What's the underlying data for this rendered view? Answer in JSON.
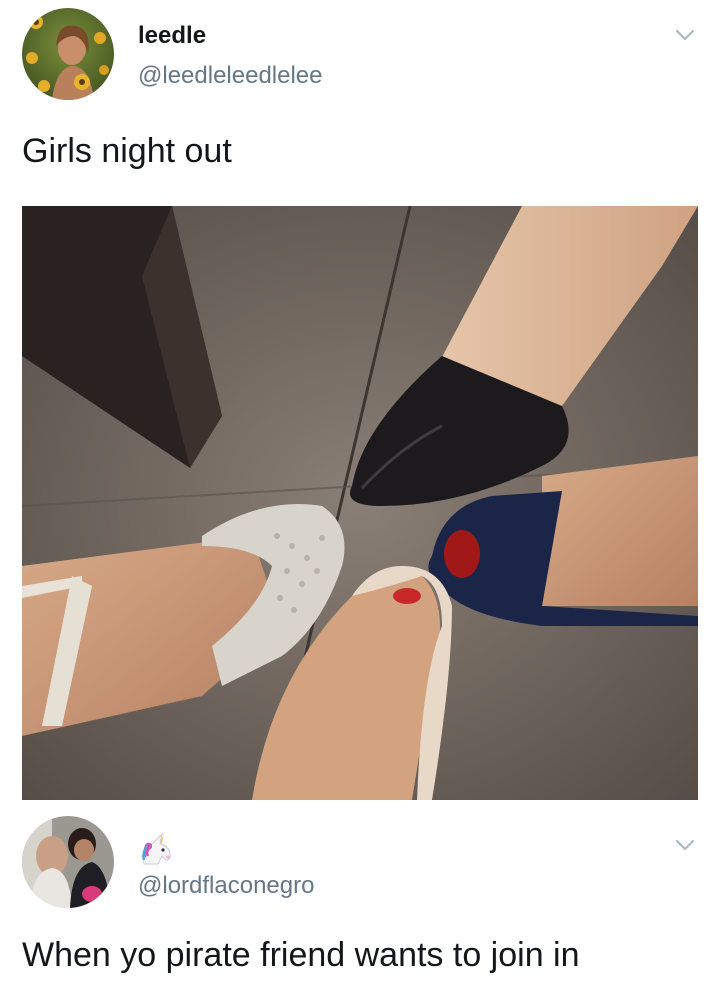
{
  "tweets": [
    {
      "user": {
        "display_name": "leedle",
        "handle": "@leedleleedlelee"
      },
      "text": "Girls night out",
      "media_description": "photo of five feet in heels in a circle, one dark wooden table leg"
    },
    {
      "user": {
        "display_name_icon": "unicorn-emoji",
        "handle": "@lordflaconegro"
      },
      "text": "When yo pirate friend wants to join in"
    }
  ],
  "colors": {
    "text_primary": "#14171a",
    "text_secondary": "#657786",
    "chevron": "#aab8c2"
  },
  "icons": [
    "chevron-down-icon",
    "unicorn-icon"
  ]
}
